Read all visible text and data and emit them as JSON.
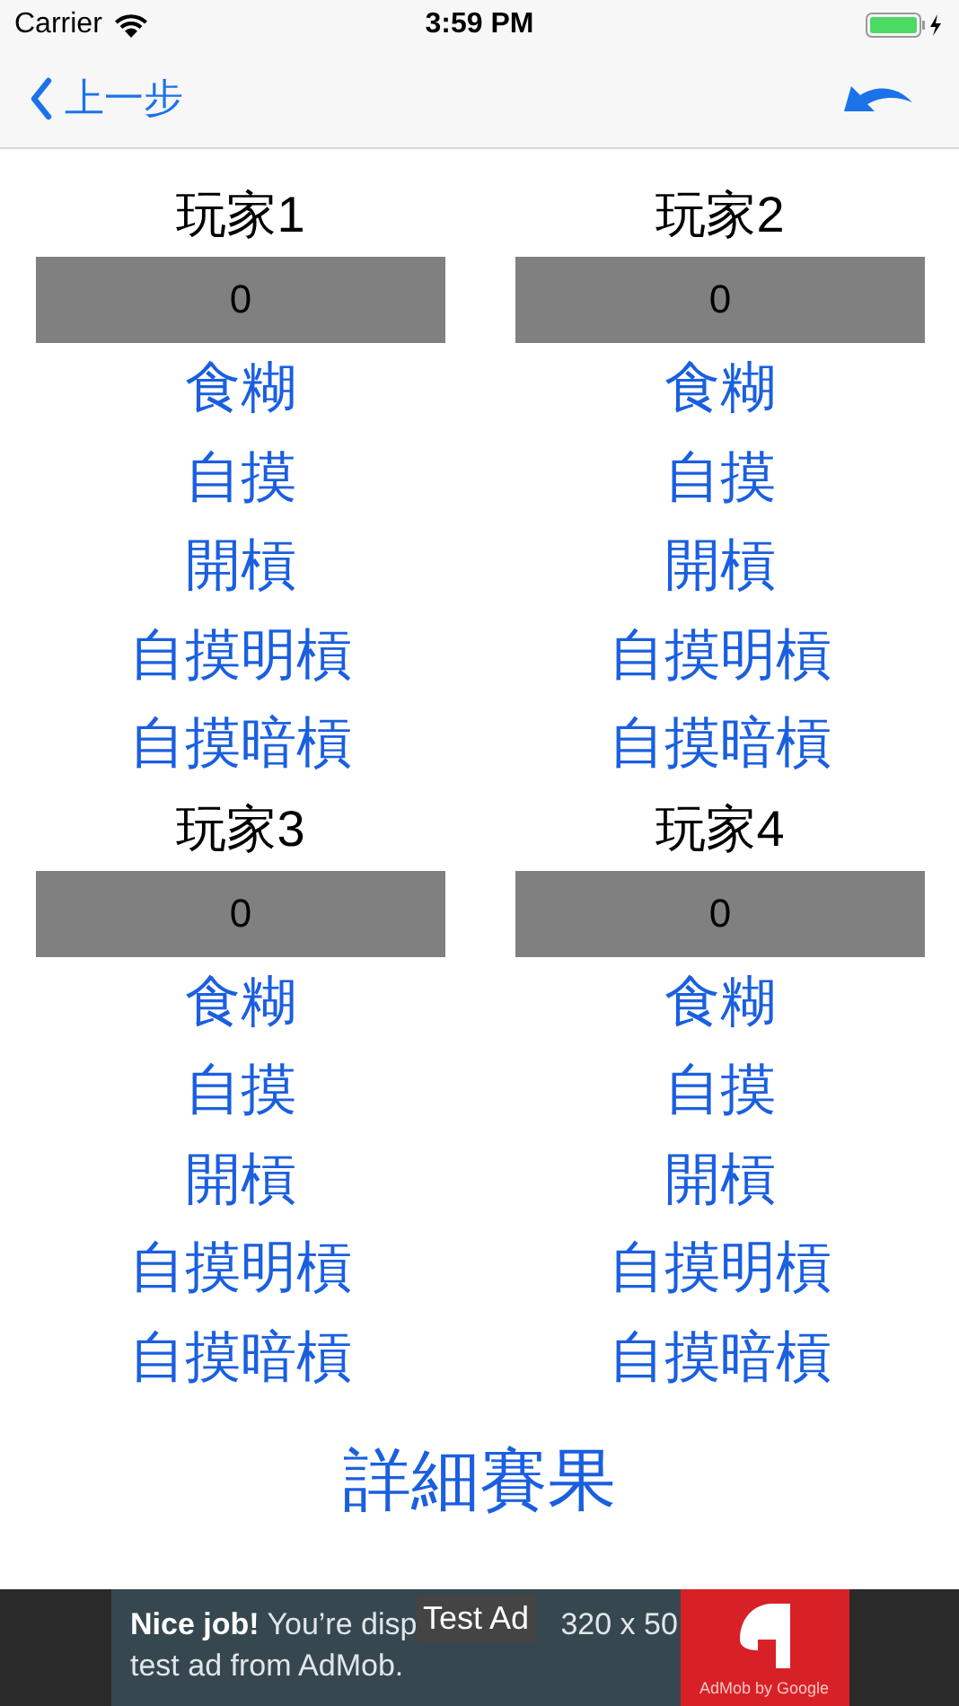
{
  "status_bar": {
    "carrier": "Carrier",
    "time": "3:59 PM"
  },
  "nav": {
    "back_label": "上一步"
  },
  "players": [
    {
      "name": "玩家1",
      "score": "0",
      "actions": [
        "食糊",
        "自摸",
        "開槓",
        "自摸明槓",
        "自摸暗槓"
      ]
    },
    {
      "name": "玩家2",
      "score": "0",
      "actions": [
        "食糊",
        "自摸",
        "開槓",
        "自摸明槓",
        "自摸暗槓"
      ]
    },
    {
      "name": "玩家3",
      "score": "0",
      "actions": [
        "食糊",
        "自摸",
        "開槓",
        "自摸明槓",
        "自摸暗槓"
      ]
    },
    {
      "name": "玩家4",
      "score": "0",
      "actions": [
        "食糊",
        "自摸",
        "開槓",
        "自摸明槓",
        "自摸暗槓"
      ]
    }
  ],
  "details_button": "詳細賽果",
  "ad": {
    "line1_start": "**Nice job!** You’re disp",
    "line1_end": "320 x 50",
    "line2": "test ad from AdMob.",
    "badge": "Test Ad",
    "brand": "AdMob by Google"
  }
}
